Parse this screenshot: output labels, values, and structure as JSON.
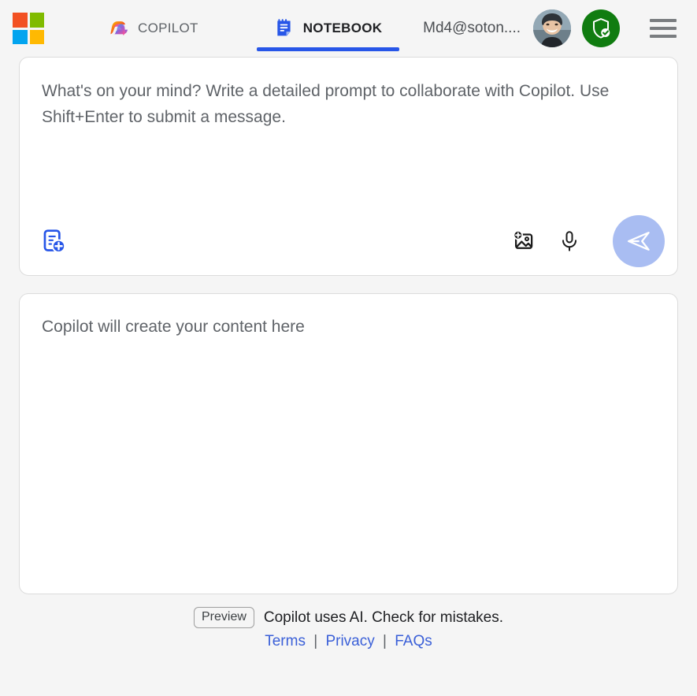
{
  "header": {
    "logo": {
      "name": "microsoft-logo",
      "squares": [
        {
          "name": "red",
          "color": "#f25022"
        },
        {
          "name": "green",
          "color": "#80bb00"
        },
        {
          "name": "blue",
          "color": "#02a4ef"
        },
        {
          "name": "amber",
          "color": "#ffb902"
        }
      ]
    },
    "tabs": [
      {
        "label": "COPILOT",
        "icon": "copilot-swirl-icon",
        "active": false
      },
      {
        "label": "NOTEBOOK",
        "icon": "notebook-icon",
        "active": true
      }
    ],
    "account_email": "Md4@soton....",
    "avatar_icon": "user-avatar-photo",
    "shield_badge_icon": "shield-check-icon",
    "menu_icon": "hamburger-menu-icon",
    "accent_color": "#2756e8",
    "shield_color": "#107c10"
  },
  "prompt": {
    "placeholder": "What's on your mind? Write a detailed prompt to collaborate with Copilot. Use Shift+Enter to submit a message.",
    "value": "",
    "tools": {
      "add_page_label": "Add page",
      "add_page_icon": "add-page-icon",
      "add_image_label": "Add image",
      "add_image_icon": "add-image-icon",
      "microphone_label": "Voice input",
      "microphone_icon": "microphone-icon",
      "send_label": "Send",
      "send_icon": "send-paper-plane-icon",
      "send_color": "#a9bdf2",
      "add_page_color": "#2756e8"
    }
  },
  "content": {
    "placeholder": "Copilot will create your content here"
  },
  "footer": {
    "preview_badge": "Preview",
    "disclaimer": "Copilot uses AI. Check for mistakes.",
    "links": [
      {
        "label": "Terms"
      },
      {
        "label": "Privacy"
      },
      {
        "label": "FAQs"
      }
    ],
    "separator": "|",
    "link_color": "#3b60d8"
  }
}
